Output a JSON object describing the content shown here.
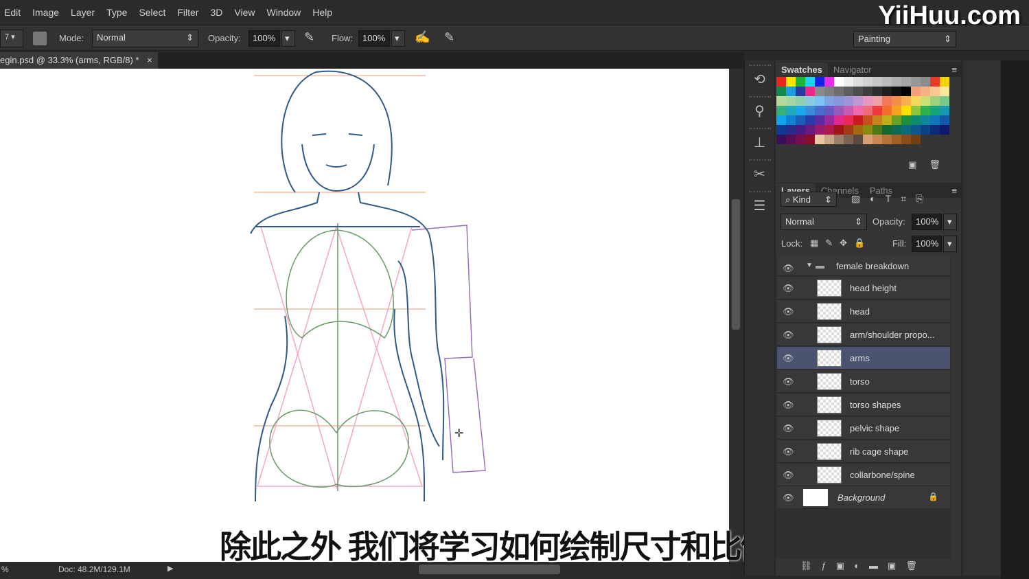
{
  "menu": [
    "Edit",
    "Image",
    "Layer",
    "Type",
    "Select",
    "Filter",
    "3D",
    "View",
    "Window",
    "Help"
  ],
  "logo": "YiiHuu.com",
  "options": {
    "brush_size": "7",
    "mode_label": "Mode:",
    "mode_value": "Normal",
    "opacity_label": "Opacity:",
    "opacity_value": "100%",
    "flow_label": "Flow:",
    "flow_value": "100%",
    "workspace": "Painting"
  },
  "document_tab": {
    "title": "egin.psd @ 33.3% (arms, RGB/8) *",
    "close": "×"
  },
  "status": {
    "zoom": "%",
    "doc": "Doc: 48.2M/129.1M"
  },
  "subtitle": "除此之外 我们将学习如何绘制尺寸和比例",
  "swatches": {
    "tabs": [
      "Swatches",
      "Navigator"
    ],
    "rows": [
      [
        "#e8261c",
        "#f7e600",
        "#1db53a",
        "#1ed3ef",
        "#1520e8",
        "#e62ee8",
        "#ffffff",
        "#eeeeee",
        "#dddddd",
        "#d2d2d2",
        "#c6c6c6",
        "#bcbcbc",
        "#b0b0b0",
        "#a4a4a4",
        "#989898",
        "#8d8d8d",
        "#e83a26",
        "#f2d500"
      ],
      [
        "#148a4a",
        "#1f9be0",
        "#2a3aa0",
        "#e8288a",
        "#8a8a8a",
        "#7e7e7e",
        "#6e6e6e",
        "#5e5e5e",
        "#4e4e4e",
        "#3e3e3e",
        "#2e2e2e",
        "#1e1e1e",
        "#101010",
        "#000000",
        "#f4a07a",
        "#f6b284",
        "#f8c890",
        "#fbe69a"
      ],
      [
        "#b8d89a",
        "#a6d6a2",
        "#92d0b2",
        "#88cce0",
        "#7cc4f2",
        "#7ea4e4",
        "#8a96dc",
        "#a292d6",
        "#c296d2",
        "#e698c2",
        "#f0a0a4",
        "#f2785a",
        "#f48c4a",
        "#f6b050",
        "#f4d85a",
        "#cce07a",
        "#9cd27a",
        "#7cc88a"
      ],
      [
        "#38b07a",
        "#22a8b8",
        "#1aa8ea",
        "#3c8ad8",
        "#4a6ad0",
        "#6a58c0",
        "#9a58b8",
        "#c85ab2",
        "#ee6aa8",
        "#f26a78",
        "#ec3a3a",
        "#f2702a",
        "#f6a21e",
        "#fde000",
        "#8cc63e",
        "#2eb04e",
        "#16a27a",
        "#1898b2"
      ],
      [
        "#12a4ea",
        "#1080d0",
        "#1a60b8",
        "#2a3aa8",
        "#5a2aa0",
        "#9a2a9a",
        "#e02a8a",
        "#ec2a5a",
        "#c81c1c",
        "#c8501a",
        "#c8821a",
        "#c0b018",
        "#6aa024",
        "#1c9040",
        "#108a6e",
        "#10849e",
        "#1074b8",
        "#1058a8"
      ],
      [
        "#0e3a90",
        "#2a2a88",
        "#4a1a84",
        "#6a1a7a",
        "#9a1a6e",
        "#b01a4a",
        "#a01414",
        "#a03c10",
        "#a06a10",
        "#8a8a10",
        "#4a7a1a",
        "#126a30",
        "#0e6a52",
        "#0e6a7a",
        "#0e5890",
        "#0e4288",
        "#0e2a7a",
        "#101a6a"
      ],
      [
        "#3a0e5a",
        "#5a0e52",
        "#7a0e4a",
        "#8a0e2a",
        "#e8c8a0",
        "#c8a888",
        "#9a8068",
        "#7a6454",
        "#5a4a40",
        "#d8a070",
        "#c88850",
        "#b87438",
        "#a06028",
        "#8a4c1a",
        "#704010"
      ]
    ]
  },
  "layers": {
    "tabs": [
      "Layers",
      "Channels",
      "Paths"
    ],
    "filter": "Kind",
    "blend": "Normal",
    "opacity_label": "Opacity:",
    "opacity": "100%",
    "lock_label": "Lock:",
    "fill_label": "Fill:",
    "fill": "100%",
    "group": "female breakdown",
    "items": [
      "head height",
      "head",
      "arm/shoulder propo...",
      "arms",
      "torso",
      "torso shapes",
      "pelvic shape",
      "rib cage shape",
      "collarbone/spine"
    ],
    "selected": "arms",
    "background": "Background"
  }
}
